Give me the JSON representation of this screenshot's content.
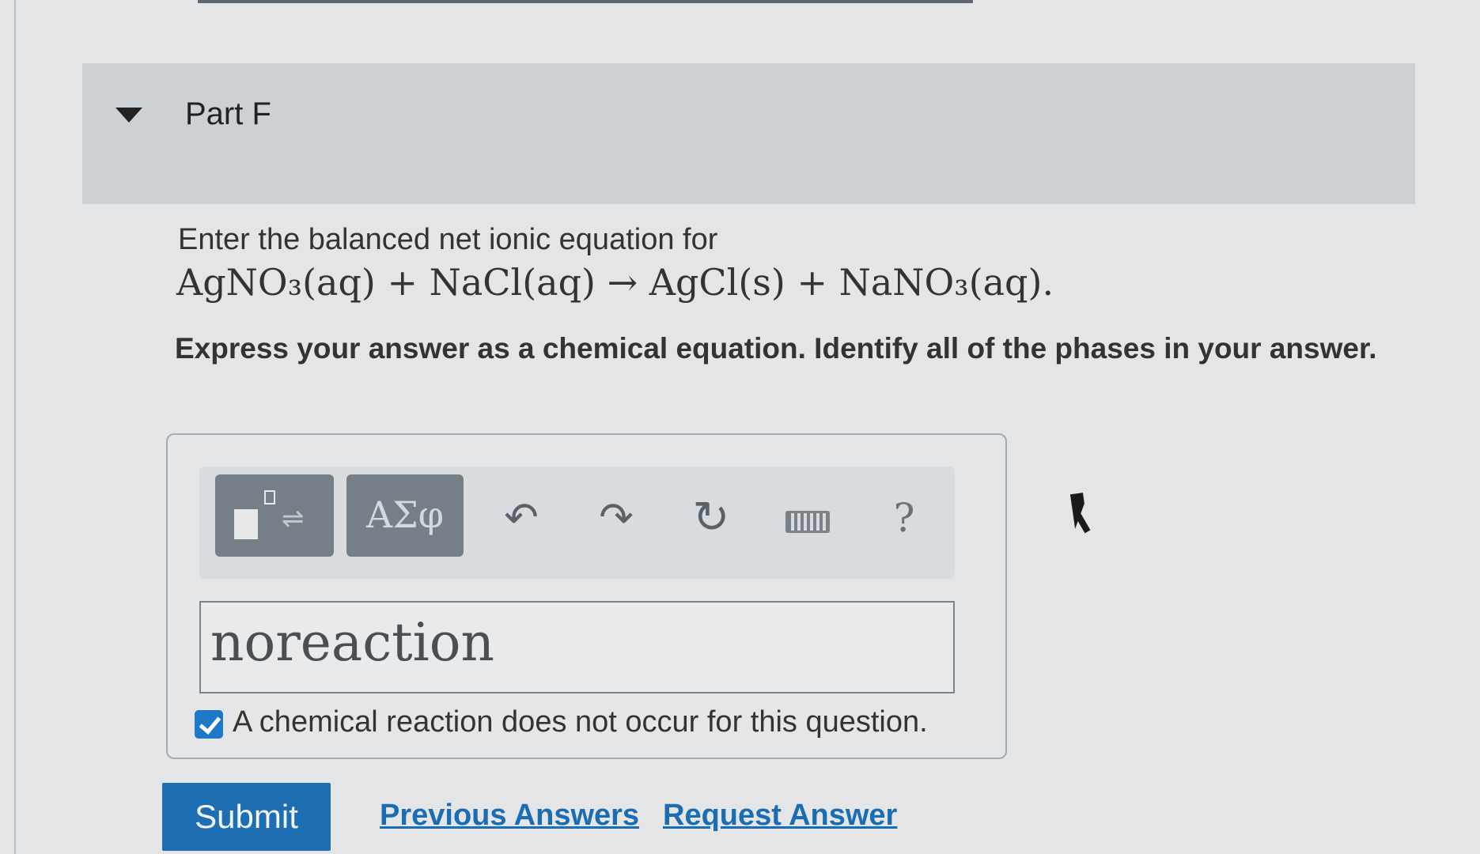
{
  "part": {
    "title": "Part F"
  },
  "question": {
    "prompt": "Enter the balanced net ionic equation for",
    "equation": "AgNO₃(aq) + NaCl(aq) → AgCl(s) + NaNO₃(aq).",
    "instructions": "Express your answer as a chemical equation. Identify all of the phases in your answer."
  },
  "toolbar": {
    "symbols_label": "ΑΣφ",
    "undo_glyph": "↶",
    "redo_glyph": "↷",
    "reset_glyph": "↻",
    "help_label": "?"
  },
  "answer": {
    "value": "noreaction",
    "no_reaction_label": "A chemical reaction does not occur for this question.",
    "no_reaction_checked": true
  },
  "actions": {
    "submit_label": "Submit",
    "previous_answers_label": "Previous Answers",
    "request_answer_label": "Request Answer"
  },
  "colors": {
    "header_bg": "#ccd1d6",
    "primary_button": "#1e6eb4",
    "link": "#1b6db3",
    "checkbox": "#1e78c8"
  }
}
